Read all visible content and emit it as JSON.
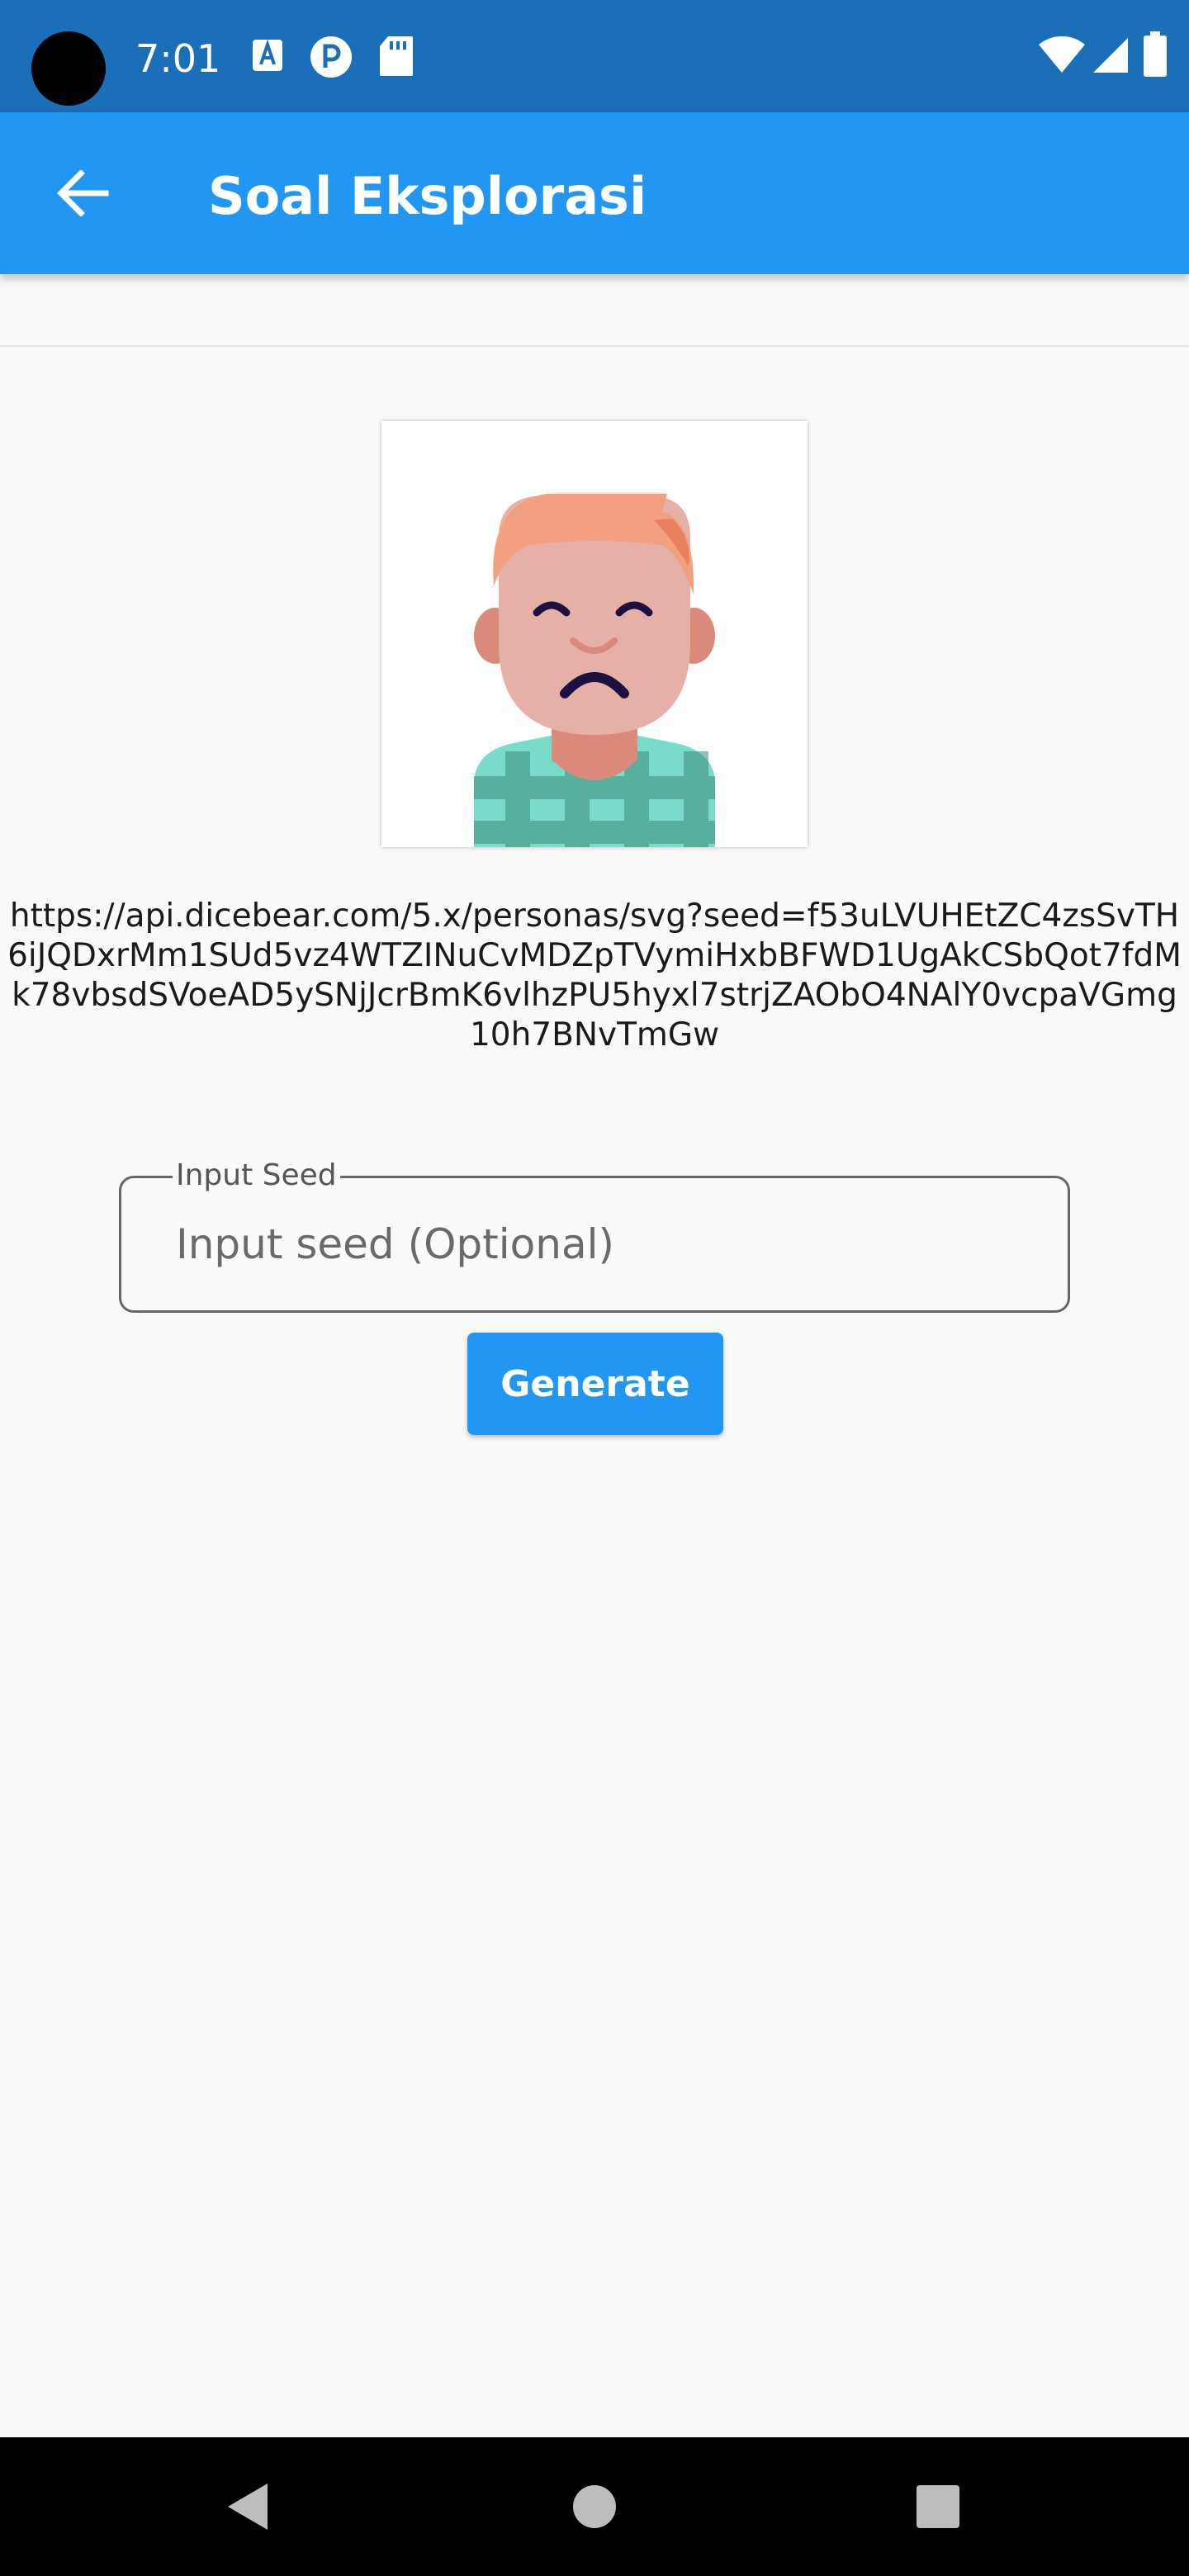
{
  "status_bar": {
    "time": "7:01",
    "left_icons": [
      "a-notification-icon",
      "p-notification-icon",
      "sd-card-icon"
    ],
    "right_icons": [
      "wifi-icon",
      "signal-icon",
      "battery-icon"
    ]
  },
  "app_bar": {
    "title": "Soal Eksplorasi",
    "back_icon": "arrow-back-icon",
    "color": "#2196f3"
  },
  "avatar": {
    "description_icon": "persona-avatar"
  },
  "url_text": "https://api.dicebear.com/5.x/personas/svg?seed=f53uLVUHEtZC4zsSvTH6iJQDxrMm1SUd5vz4WTZINuCvMDZpTVymiHxbBFWD1UgAkCSbQot7fdMk78vbsdSVoeAD5ySNjJcrBmK6vlhzPU5hyxl7strjZAObO4NAlY0vcpaVGmg10h7BNvTmGw",
  "input": {
    "label": "Input Seed",
    "placeholder": "Input seed (Optional)",
    "value": ""
  },
  "generate_button": {
    "label": "Generate"
  },
  "nav_bar": {
    "back_icon": "nav-back-icon",
    "home_icon": "nav-home-icon",
    "recents_icon": "nav-recents-icon"
  }
}
